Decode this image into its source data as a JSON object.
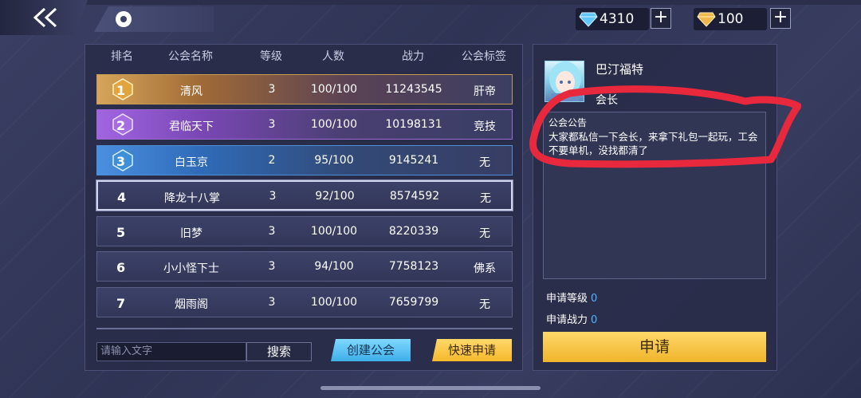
{
  "top": {
    "diamond_amount": "4310",
    "gold_amount": "100",
    "plus_label": "+"
  },
  "table": {
    "headers": [
      "排名",
      "公会名称",
      "等级",
      "人数",
      "战力",
      "公会标签"
    ],
    "rows": [
      {
        "rank": "1",
        "name": "清风",
        "level": "3",
        "members": "100/100",
        "power": "11243545",
        "tag": "肝帝"
      },
      {
        "rank": "2",
        "name": "君临天下",
        "level": "3",
        "members": "100/100",
        "power": "10198131",
        "tag": "竞技"
      },
      {
        "rank": "3",
        "name": "白玉京",
        "level": "2",
        "members": "95/100",
        "power": "9145241",
        "tag": "无"
      },
      {
        "rank": "4",
        "name": "降龙十八掌",
        "level": "3",
        "members": "92/100",
        "power": "8574592",
        "tag": "无"
      },
      {
        "rank": "5",
        "name": "旧梦",
        "level": "3",
        "members": "100/100",
        "power": "8220339",
        "tag": "无"
      },
      {
        "rank": "6",
        "name": "小小怪下士",
        "level": "3",
        "members": "94/100",
        "power": "7758123",
        "tag": "佛系"
      },
      {
        "rank": "7",
        "name": "烟雨阁",
        "level": "3",
        "members": "100/100",
        "power": "7659799",
        "tag": "无"
      }
    ]
  },
  "bottom": {
    "search_placeholder": "请输入文字",
    "search_label": "搜索",
    "create_label": "创建公会",
    "quick_apply_label": "快速申请"
  },
  "detail": {
    "leader_name": "巴汀福特",
    "leader_role": "会长",
    "notice_title": "公会公告",
    "notice_text": "大家都私信一下会长，来拿下礼包一起玩，工会不要单机，没找都清了",
    "req_level_label": "申请等级",
    "req_level_value": "0",
    "req_power_label": "申请战力",
    "req_power_value": "0",
    "apply_label": "申请"
  },
  "colors": {
    "accent_blue": "#4fb3ff",
    "button_gold": "#f5b92d",
    "button_cyan": "#3eaee8",
    "annotation_red": "#e8283c"
  }
}
